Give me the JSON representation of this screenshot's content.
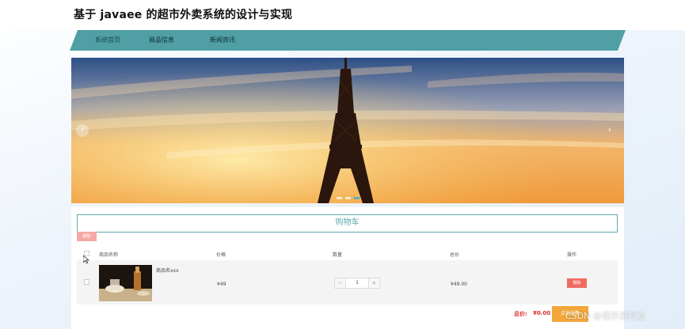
{
  "site": {
    "title": "基于 javaee 的超市外卖系统的设计与实现"
  },
  "nav": {
    "items": [
      {
        "label": "系统首页"
      },
      {
        "label": "商品信息"
      },
      {
        "label": "新闻资讯"
      }
    ],
    "color": "#4f9fa5"
  },
  "banner": {
    "prev_icon": "chevron-left-icon",
    "next_icon": "chevron-right-icon",
    "prev_glyph": "‹",
    "next_glyph": "›",
    "slide_count": 3,
    "active_slide": 3
  },
  "cart": {
    "title": "购物车",
    "delete_selected_label": "删除",
    "columns": [
      "商品名称",
      "价格",
      "数量",
      "总价",
      "操作"
    ],
    "items": [
      {
        "name": "商品名xxx",
        "price": "¥49",
        "quantity": "1",
        "subtotal": "¥49.00",
        "delete_label": "删除"
      }
    ],
    "total_label": "总价:",
    "total_value": "¥0.00",
    "checkout_label": "点击结算",
    "stepper_minus": "−",
    "stepper_plus": "+"
  },
  "colors": {
    "accent": "#5fa7ad",
    "delete": "#f06a60",
    "checkout": "#f3a63a",
    "total": "#d9302c"
  },
  "watermark": "CSDN @程序员阿龙"
}
